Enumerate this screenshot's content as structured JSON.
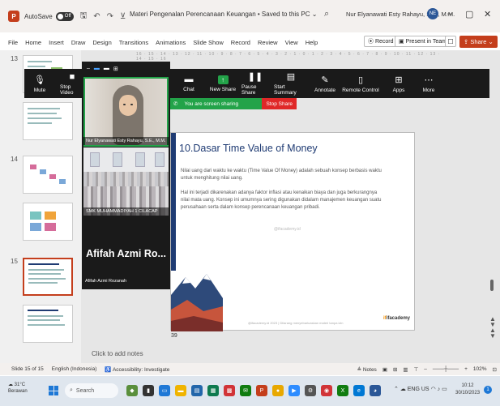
{
  "titlebar": {
    "app_icon": "P",
    "autosave_label": "AutoSave",
    "autosave_state": "Off",
    "doc_title": "Materi Pengenalan Perencanaan Keuangan • Saved to this PC ⌄",
    "user_name": "Nur Elyanawati Esty Rahayu, S.E., M.M.",
    "avatar_initials": "NE"
  },
  "menu": {
    "items": [
      "File",
      "Home",
      "Insert",
      "Draw",
      "Design",
      "Transitions",
      "Animations",
      "Slide Show",
      "Record",
      "Review",
      "View",
      "Help"
    ],
    "record_label": "⦿ Record",
    "present_label": "▣ Present in Teams",
    "share_label": "⇪ Share ⌄"
  },
  "thumbnails": {
    "nums": [
      "13",
      "14",
      "15"
    ]
  },
  "ruler": {
    "text": "16 · 15 · 14 · 13 · 12 · 11 · 10 · 9 · 8 · 7 · 6 · 5 · 4 · 3 · 2 · 1 · 0 · 1 · 2 · 3 · 4 · 5 · 6 · 7 · 8 · 9 · 10 · 11 · 12 · 13 · 14 · 15 · 16"
  },
  "zoom_toolbar": {
    "tools": [
      {
        "label": "Mute",
        "icon": "microphone-icon"
      },
      {
        "label": "Stop Video",
        "icon": "video-icon"
      },
      {
        "label": "Chat",
        "icon": "chat-icon"
      },
      {
        "label": "New Share",
        "icon": "share-icon"
      },
      {
        "label": "Pause Share",
        "icon": "pause-icon"
      },
      {
        "label": "Start Summary",
        "icon": "summary-icon"
      },
      {
        "label": "Annotate",
        "icon": "pen-icon"
      },
      {
        "label": "Remote Control",
        "icon": "mouse-icon"
      },
      {
        "label": "Apps",
        "icon": "apps-icon"
      },
      {
        "label": "More",
        "icon": "more-icon"
      }
    ],
    "sharing_text": "You are screen sharing",
    "stop_share_label": "Stop Share"
  },
  "video_panel": {
    "participant1_name": "Nur Elyanawati Esty Rahayu, S.E., M.M.",
    "participant2_name": "SMK MUHAMMADIYAH 1 CILACAP",
    "participant3_big_name": "Afifah Azmi Ro...",
    "participant3_name": "Afifah Azmi Rozanah"
  },
  "slide": {
    "title": "10.Dasar Time Value of Money",
    "paragraph1": "Nilai uang dari waktu ke waktu (Time Value Of Money) adalah sebuah konsep berbasis waktu untuk menghitung nilai uang.",
    "paragraph2": "Hal ini terjadi dikarenakan adanya faktor inflasi atau kenaikan biaya dan juga berkurangnya nilai mata uang. Konsep ini umumnya sering digunakan didalam manajemen keuangan suatu perusahaan serta dalam konsep perencanaan keuangan pribadi.",
    "watermark": "@ifacademy.id",
    "footer": "@ifacademy.id 2023 | Dilarang menyebarluaskan materi tanpa izin",
    "logo_text": "ifacademy",
    "slide_number": "39"
  },
  "notes_placeholder": "Click to add notes",
  "statusbar": {
    "slide_info": "Slide 15 of 15",
    "language": "English (Indonesia)",
    "accessibility": "♿ Accessibility: Investigate",
    "notes_label": "≜ Notes",
    "zoom_percent": "102%"
  },
  "taskbar": {
    "weather_temp": "31°C",
    "weather_text": "Berawan",
    "search_label": "Search",
    "tray_lang": "ENG US",
    "time": "10:12",
    "date": "30/10/2023",
    "notif_count": "1"
  }
}
